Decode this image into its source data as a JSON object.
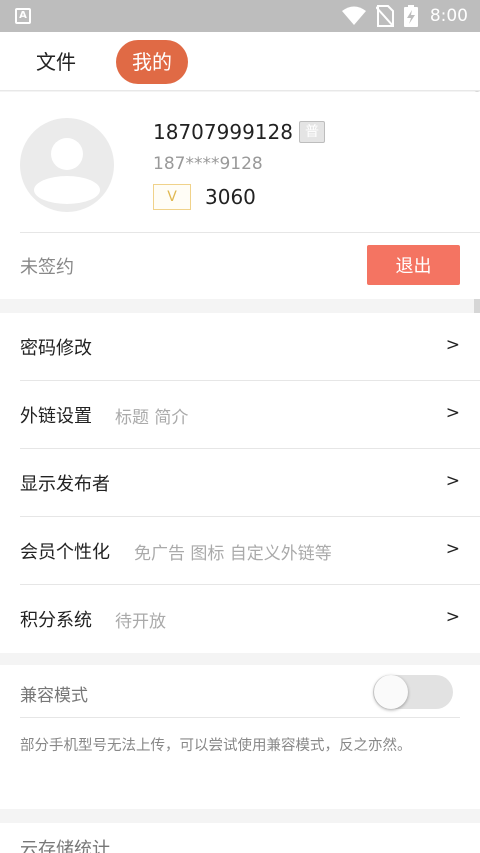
{
  "status_bar": {
    "app_badge": "A",
    "time": "8:00",
    "icons": [
      "wifi-icon",
      "no-sim-icon",
      "battery-charging-icon"
    ]
  },
  "tabs": [
    {
      "label": "文件",
      "active": false
    },
    {
      "label": "我的",
      "active": true
    }
  ],
  "colors": {
    "accent": "#e06a45",
    "logout": "#f47462"
  },
  "profile": {
    "phone": "18707999128",
    "level_badge": "普",
    "masked_phone": "187****9128",
    "vip_badge": "V",
    "points": "3060",
    "sign_status": "未签约",
    "logout_label": "退出"
  },
  "menu": [
    {
      "title": "密码修改",
      "subtitle": "",
      "chevron": ">"
    },
    {
      "title": "外链设置",
      "subtitle": "标题 简介",
      "chevron": ">"
    },
    {
      "title": "显示发布者",
      "subtitle": "",
      "chevron": ">"
    },
    {
      "title": "会员个性化",
      "subtitle": "免广告 图标 自定义外链等",
      "chevron": ">"
    },
    {
      "title": "积分系统",
      "subtitle": "待开放",
      "chevron": ">"
    }
  ],
  "compat": {
    "title": "兼容模式",
    "enabled": false,
    "description": "部分手机型号无法上传，可以尝试使用兼容模式，反之亦然。"
  },
  "cloud": {
    "title": "云存储统计"
  }
}
